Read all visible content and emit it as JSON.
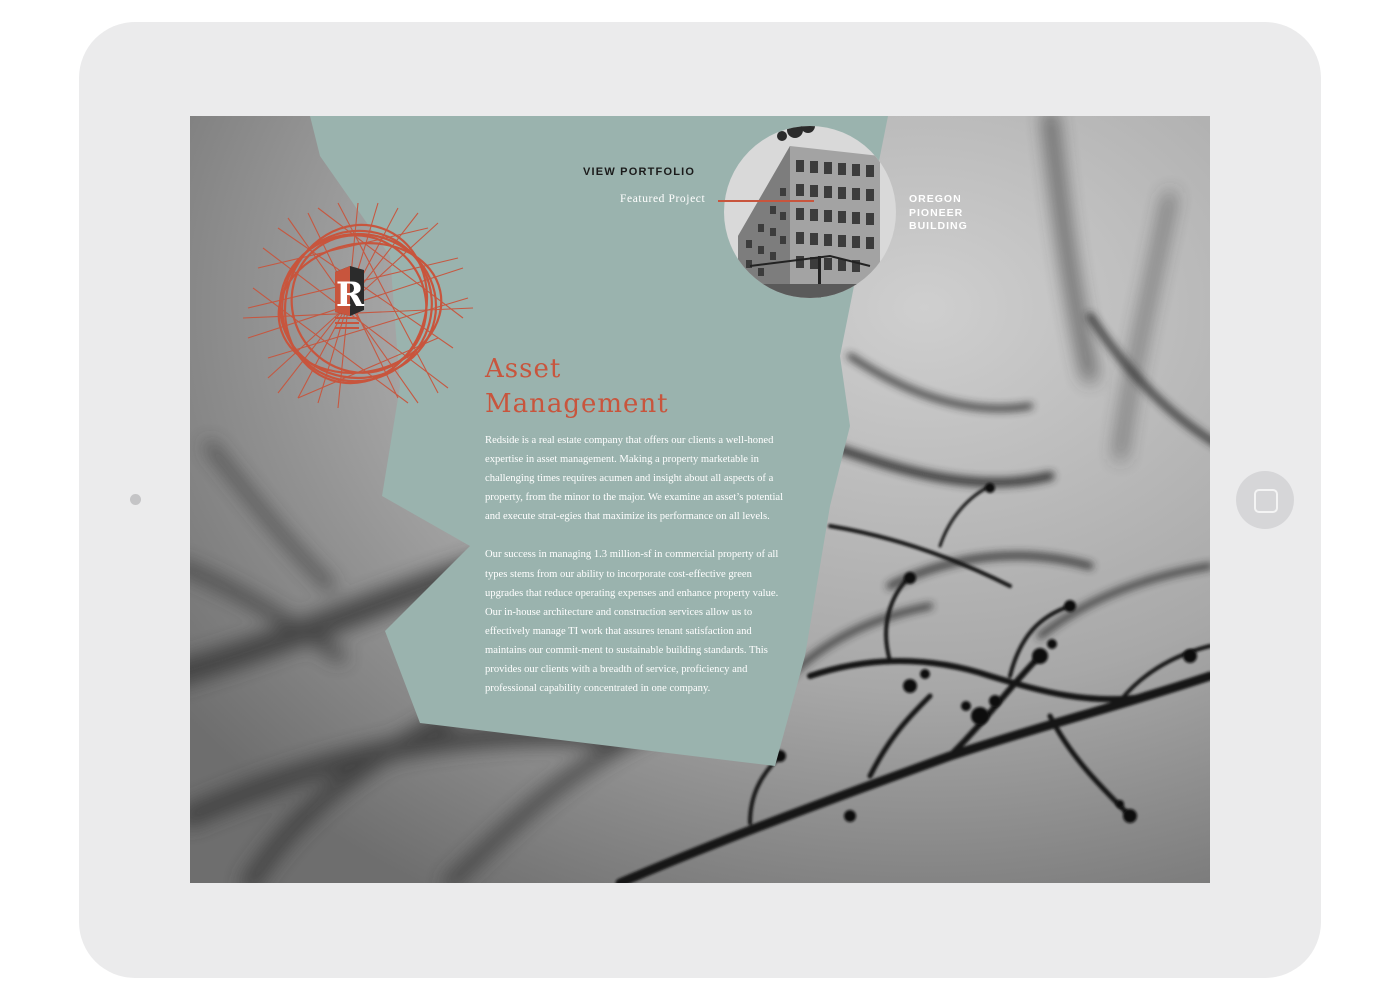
{
  "colors": {
    "device_frame": "#ebebec",
    "panel": "#9ab3ae",
    "accent": "#c8553d",
    "panel_text": "#ffffff",
    "nav_text": "#1b1b1b"
  },
  "nav": {
    "view_portfolio": "VIEW PORTFOLIO",
    "menu_icon": "hamburger-menu-icon"
  },
  "featured": {
    "label": "Featured Project",
    "project_lines": [
      "OREGON",
      "PIONEER",
      "BUILDING"
    ],
    "photo": "building-photo-icon"
  },
  "logo": {
    "letter": "R",
    "icon": "redside-logo-icon"
  },
  "main": {
    "title_line1": "Asset",
    "title_line2": "Management",
    "paragraphs": [
      "Redside is a real estate company that offers our clients a well-honed expertise in asset management. Making a property marketable in challenging times requires acumen and insight about all aspects of a property, from the minor to the major. We examine an asset’s potential and execute strat-egies that maximize its performance on all levels.",
      "Our success in managing 1.3 million-sf in commercial property of all types stems from our ability to incorporate cost-effective green upgrades that reduce operating expenses and enhance property value. Our in-house architecture and construction services allow us to effectively manage TI work that assures tenant satisfaction and maintains our commit-ment to sustainable building standards. This provides our clients with a breadth of service, proficiency and professional capability concentrated in one company."
    ]
  },
  "device": {
    "home_button": "home-button-icon",
    "camera": "front-camera-icon"
  }
}
